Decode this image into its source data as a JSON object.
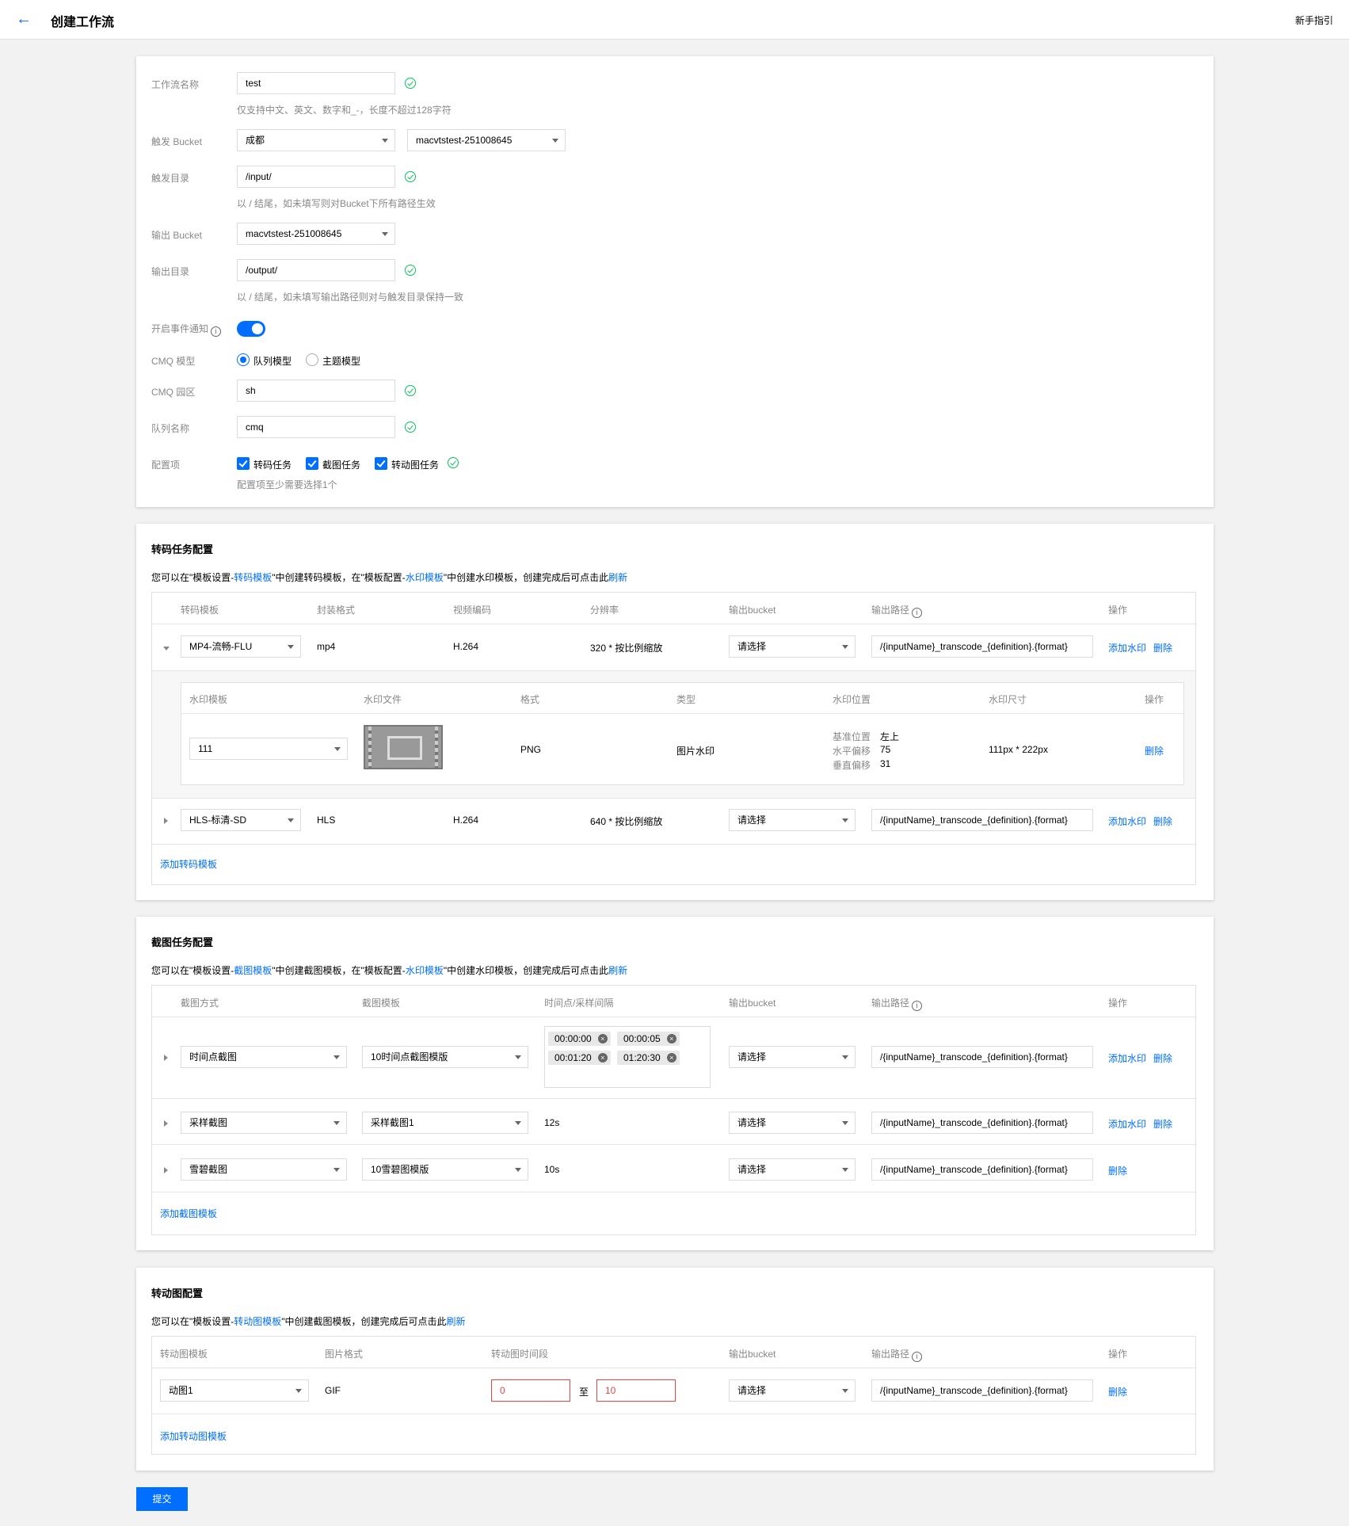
{
  "header": {
    "title": "创建工作流",
    "guide": "新手指引"
  },
  "basic": {
    "name_label": "工作流名称",
    "name_value": "test",
    "name_hint": "仅支持中文、英文、数字和_-，长度不超过128字符",
    "trigger_bucket_label": "触发 Bucket",
    "trigger_region": "成都",
    "trigger_bucket": "macvtstest-251008645",
    "trigger_dir_label": "触发目录",
    "trigger_dir": "/input/",
    "trigger_dir_hint": "以 / 结尾，如未填写则对Bucket下所有路径生效",
    "output_bucket_label": "输出 Bucket",
    "output_bucket": "macvtstest-251008645",
    "output_dir_label": "输出目录",
    "output_dir": "/output/",
    "output_dir_hint": "以 / 结尾，如未填写输出路径则对与触发目录保持一致",
    "event_label": "开启事件通知",
    "cmq_model_label": "CMQ 模型",
    "cmq_queue": "队列模型",
    "cmq_topic": "主题模型",
    "cmq_region_label": "CMQ 园区",
    "cmq_region": "sh",
    "queue_label": "队列名称",
    "queue_name": "cmq",
    "config_label": "配置项",
    "cfg_transcode": "转码任务",
    "cfg_snapshot": "截图任务",
    "cfg_animation": "转动图任务",
    "config_hint": "配置项至少需要选择1个"
  },
  "transcode": {
    "title": "转码任务配置",
    "desc_pre": "您可以在\"模板设置-",
    "desc_link1": "转码模板",
    "desc_mid": "\"中创建转码模板，在\"模板配置-",
    "desc_link2": "水印模板",
    "desc_post": "\"中创建水印模板，创建完成后可点击此",
    "refresh": "刷新",
    "headers": [
      "转码模板",
      "封装格式",
      "视频编码",
      "分辨率",
      "输出bucket",
      "输出路径",
      "操作"
    ],
    "rows": [
      {
        "template": "MP4-流畅-FLU",
        "format": "mp4",
        "codec": "H.264",
        "resolution": "320 * 按比例缩放",
        "bucket": "请选择",
        "path": "/{inputName}_transcode_{definition}.{format}",
        "add_wm": "添加水印",
        "delete": "删除"
      },
      {
        "template": "HLS-标清-SD",
        "format": "HLS",
        "codec": "H.264",
        "resolution": "640 * 按比例缩放",
        "bucket": "请选择",
        "path": "/{inputName}_transcode_{definition}.{format}",
        "add_wm": "添加水印",
        "delete": "删除"
      }
    ],
    "wm_headers": [
      "水印模板",
      "水印文件",
      "格式",
      "类型",
      "水印位置",
      "水印尺寸",
      "操作"
    ],
    "wm": {
      "template": "111",
      "format": "PNG",
      "type": "图片水印",
      "pos_base_label": "基准位置",
      "pos_base": "左上",
      "pos_h_label": "水平偏移",
      "pos_h": "75",
      "pos_v_label": "垂直偏移",
      "pos_v": "31",
      "size": "111px * 222px",
      "delete": "删除"
    },
    "add": "添加转码模板"
  },
  "snapshot": {
    "title": "截图任务配置",
    "desc_pre": "您可以在\"模板设置-",
    "desc_link1": "截图模板",
    "desc_mid": "\"中创建截图模板，在\"模板配置-",
    "desc_link2": "水印模板",
    "desc_post": "\"中创建水印模板，创建完成后可点击此",
    "refresh": "刷新",
    "headers": [
      "截图方式",
      "截图模板",
      "时间点/采样间隔",
      "输出bucket",
      "输出路径",
      "操作"
    ],
    "rows": [
      {
        "mode": "时间点截图",
        "template": "10时间点截图模版",
        "times": [
          "00:00:00",
          "00:00:05",
          "00:01:20",
          "01:20:30"
        ],
        "bucket": "请选择",
        "path": "/{inputName}_transcode_{definition}.{format}",
        "add_wm": "添加水印",
        "delete": "删除"
      },
      {
        "mode": "采样截图",
        "template": "采样截图1",
        "interval": "12s",
        "bucket": "请选择",
        "path": "/{inputName}_transcode_{definition}.{format}",
        "add_wm": "添加水印",
        "delete": "删除"
      },
      {
        "mode": "雪碧截图",
        "template": "10雪碧图模版",
        "interval": "10s",
        "bucket": "请选择",
        "path": "/{inputName}_transcode_{definition}.{format}",
        "delete": "删除"
      }
    ],
    "add": "添加截图模板"
  },
  "animation": {
    "title": "转动图配置",
    "desc_pre": "您可以在\"模板设置-",
    "desc_link1": "转动图模板",
    "desc_post": "\"中创建截图模板，创建完成后可点击此",
    "refresh": "刷新",
    "headers": [
      "转动图模板",
      "图片格式",
      "转动图时间段",
      "输出bucket",
      "输出路径",
      "操作"
    ],
    "row": {
      "template": "动图1",
      "format": "GIF",
      "start": "0",
      "to": "至",
      "end": "10",
      "bucket": "请选择",
      "path": "/{inputName}_transcode_{definition}.{format}",
      "delete": "删除"
    },
    "add": "添加转动图模板"
  },
  "submit": "提交"
}
